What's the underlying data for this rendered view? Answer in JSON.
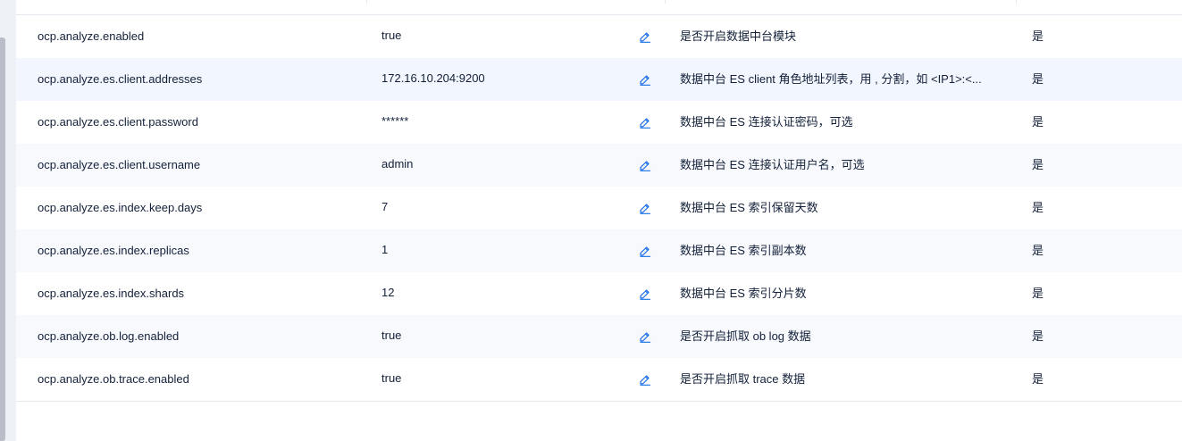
{
  "table": {
    "rows": [
      {
        "name": "ocp.analyze.enabled",
        "value": "true",
        "description": "是否开启数据中台模块",
        "required": "是"
      },
      {
        "name": "ocp.analyze.es.client.addresses",
        "value": "172.16.10.204:9200",
        "description": "数据中台 ES client 角色地址列表，用 , 分割，如 <IP1>:<...",
        "required": "是"
      },
      {
        "name": "ocp.analyze.es.client.password",
        "value": "******",
        "description": "数据中台 ES 连接认证密码，可选",
        "required": "是"
      },
      {
        "name": "ocp.analyze.es.client.username",
        "value": "admin",
        "description": "数据中台 ES 连接认证用户名，可选",
        "required": "是"
      },
      {
        "name": "ocp.analyze.es.index.keep.days",
        "value": "7",
        "description": "数据中台 ES 索引保留天数",
        "required": "是"
      },
      {
        "name": "ocp.analyze.es.index.replicas",
        "value": "1",
        "description": "数据中台 ES 索引副本数",
        "required": "是"
      },
      {
        "name": "ocp.analyze.es.index.shards",
        "value": "12",
        "description": "数据中台 ES 索引分片数",
        "required": "是"
      },
      {
        "name": "ocp.analyze.ob.log.enabled",
        "value": "true",
        "description": "是否开启抓取 ob log 数据",
        "required": "是"
      },
      {
        "name": "ocp.analyze.ob.trace.enabled",
        "value": "true",
        "description": "是否开启抓取 trace 数据",
        "required": "是"
      }
    ]
  },
  "icons": {
    "edit": "edit-pencil-icon"
  },
  "colors": {
    "accent": "#1a6ee8",
    "text": "#132039",
    "row_stripe": "#f7f9fd",
    "border": "#e4e8ef"
  }
}
